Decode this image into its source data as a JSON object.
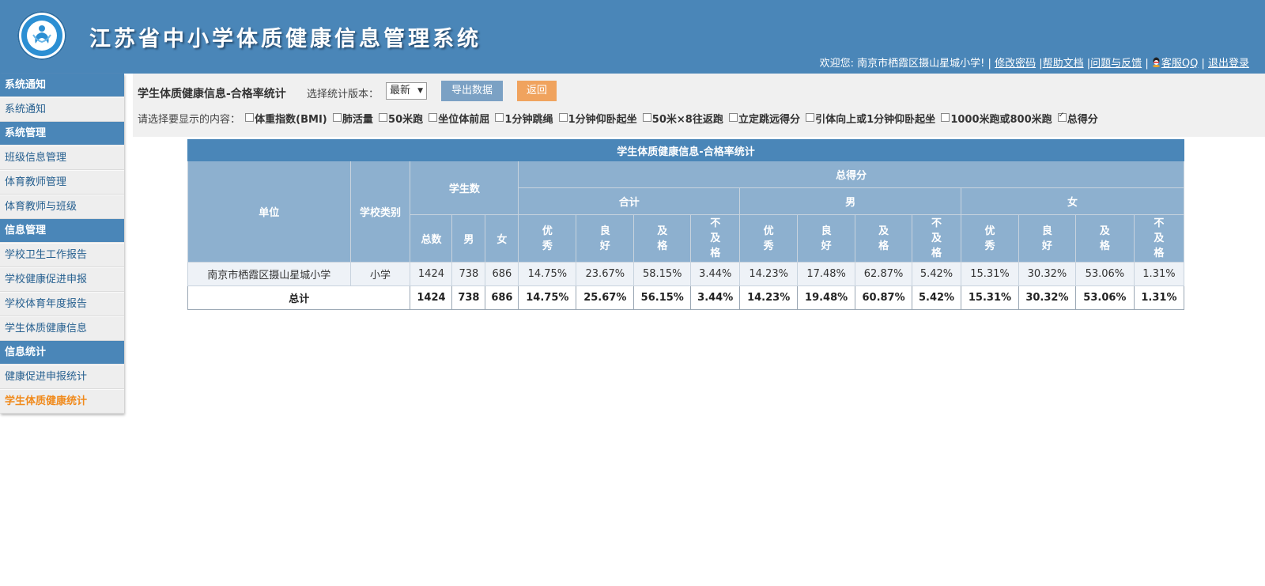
{
  "header": {
    "title": "江苏省中小学体质健康信息管理系统",
    "welcome": "欢迎您: 南京市栖霞区摄山星城小学! |",
    "links": {
      "change_password": "修改密码",
      "help_docs": "帮助文档",
      "feedback": "问题与反馈",
      "qq": "客服QQ",
      "logout": "退出登录"
    },
    "sep1": "|",
    "sep2": "|",
    "sep3": "|",
    "sep4": "|"
  },
  "sidebar": {
    "sections": [
      {
        "title": "系统通知",
        "items": [
          {
            "label": "系统通知"
          }
        ]
      },
      {
        "title": "系统管理",
        "items": [
          {
            "label": "班级信息管理"
          },
          {
            "label": "体育教师管理"
          },
          {
            "label": "体育教师与班级"
          }
        ]
      },
      {
        "title": "信息管理",
        "items": [
          {
            "label": "学校卫生工作报告"
          },
          {
            "label": "学校健康促进申报"
          },
          {
            "label": "学校体育年度报告"
          },
          {
            "label": "学生体质健康信息"
          }
        ]
      },
      {
        "title": "信息统计",
        "items": [
          {
            "label": "健康促进申报统计"
          },
          {
            "label": "学生体质健康统计",
            "active": true
          }
        ]
      }
    ]
  },
  "toolbar": {
    "page_title": "学生体质健康信息-合格率统计",
    "version_label": "选择统计版本：",
    "version_selected": "最新",
    "export_label": "导出数据",
    "back_label": "返回",
    "options_label": "请选择要显示的内容：",
    "options": [
      {
        "label": "体重指数(BMI)",
        "checked": false
      },
      {
        "label": "肺活量",
        "checked": false
      },
      {
        "label": "50米跑",
        "checked": false
      },
      {
        "label": "坐位体前屈",
        "checked": false
      },
      {
        "label": "1分钟跳绳",
        "checked": false
      },
      {
        "label": "1分钟仰卧起坐",
        "checked": false
      },
      {
        "label": "50米×8往返跑",
        "checked": false
      },
      {
        "label": "立定跳远得分",
        "checked": false
      },
      {
        "label": "引体向上或1分钟仰卧起坐",
        "checked": false
      },
      {
        "label": "1000米跑或800米跑",
        "checked": false
      },
      {
        "label": "总得分",
        "checked": true
      }
    ]
  },
  "table": {
    "caption": "学生体质健康信息-合格率统计",
    "headers": {
      "unit": "单位",
      "school_type": "学校类别",
      "student_count": "学生数",
      "total_score": "总得分",
      "group_total": "合计",
      "group_male": "男",
      "group_female": "女",
      "count_total": "总数",
      "count_male": "男",
      "count_female": "女",
      "grades": [
        "优\n秀",
        "良\n好",
        "及\n格",
        "不\n及\n格"
      ]
    },
    "rows": [
      {
        "unit": "南京市栖霞区摄山星城小学",
        "school_type": "小学",
        "values": [
          "1424",
          "738",
          "686",
          "14.75%",
          "23.67%",
          "58.15%",
          "3.44%",
          "14.23%",
          "17.48%",
          "62.87%",
          "5.42%",
          "15.31%",
          "30.32%",
          "53.06%",
          "1.31%"
        ]
      }
    ],
    "total": {
      "label": "总计",
      "values": [
        "1424",
        "738",
        "686",
        "14.75%",
        "25.67%",
        "56.15%",
        "3.44%",
        "14.23%",
        "19.48%",
        "60.87%",
        "5.42%",
        "15.31%",
        "30.32%",
        "53.06%",
        "1.31%"
      ]
    }
  }
}
